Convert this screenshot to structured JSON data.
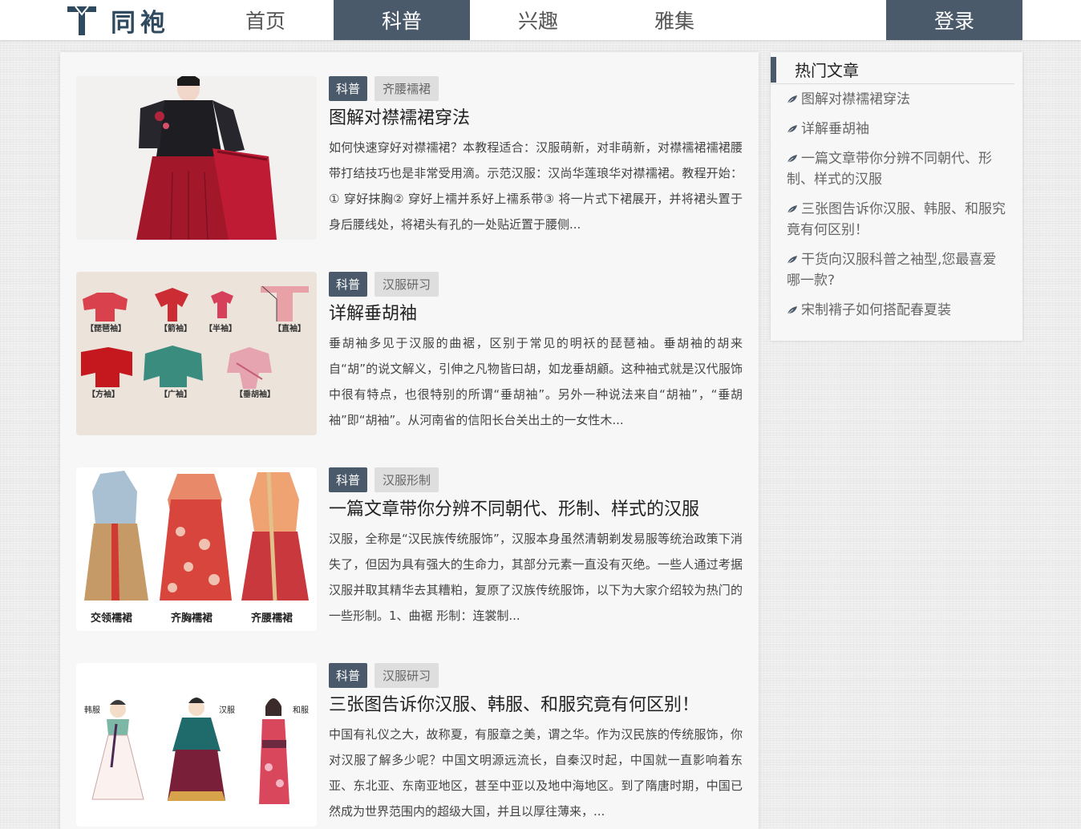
{
  "header": {
    "logo_text": "同袍",
    "nav": [
      {
        "label": "首页"
      },
      {
        "label": "科普"
      },
      {
        "label": "兴趣"
      },
      {
        "label": "雅集"
      }
    ],
    "login_label": "登录"
  },
  "articles": [
    {
      "category": "科普",
      "tag": "齐腰襦裙",
      "title": "图解对襟襦裙穿法",
      "excerpt": "如何快速穿好对襟襦裙？本教程适合：汉服萌新，对非萌新，对襟襦裙襦裙腰带打结技巧也是非常受用滴。示范汉服：汉尚华莲琅华对襟襦裙。教程开始：① 穿好抹胸② 穿好上襦并系好上襦系带③ 将一片式下裙展开，并将裙头置于身后腰线处，将裙头有孔的一处贴近置于腰侧..."
    },
    {
      "category": "科普",
      "tag": "汉服研习",
      "title": "详解垂胡袖",
      "excerpt": "垂胡袖多见于汉服的曲裾，区别于常见的明袄的琵琶袖。垂胡袖的胡来自“胡”的说文解义，引伸之凡物皆曰胡，如龙垂胡顧。这种袖式就是汉代服饰中很有特点，也很特别的所谓“垂胡袖”。另外一种说法来自“胡袖”，“垂胡袖”即“胡袖”。从河南省的信阳长台关出土的一女性木...",
      "image_labels": [
        "【琵琶袖】",
        "【箭袖】",
        "【半袖】",
        "【直袖】",
        "【方袖】",
        "【广袖】",
        "【垂胡袖】"
      ]
    },
    {
      "category": "科普",
      "tag": "汉服形制",
      "title": "一篇文章带你分辨不同朝代、形制、样式的汉服",
      "excerpt": "汉服，全称是“汉民族传统服饰”，汉服本身虽然清朝剃发易服等统治政策下消失了，但因为具有强大的生命力，其部分元素一直没有灭绝。一些人通过考据汉服并取其精华去其糟粕，复原了汉族传统服饰，以下为大家介绍较为热门的一些形制。1、曲裾 形制：连裳制...",
      "image_labels": [
        "交领襦裙",
        "齐胸襦裙",
        "齐腰襦裙"
      ]
    },
    {
      "category": "科普",
      "tag": "汉服研习",
      "title": "三张图告诉你汉服、韩服、和服究竟有何区别！",
      "excerpt": "中国有礼仪之大，故称夏，有服章之美，谓之华。作为汉民族的传统服饰，你对汉服了解多少呢？中国文明源远流长，自秦汉时起，中国就一直影响着东亚、东北亚、东南亚地区，甚至中亚以及地中海地区。到了隋唐时期，中国已然成为世界范围内的超级大国，并且以厚往薄来，...",
      "image_labels": [
        "韩服",
        "汉服",
        "和服"
      ]
    }
  ],
  "sidebar": {
    "title": "热门文章",
    "items": [
      "图解对襟襦裙穿法",
      "详解垂胡袖",
      "一篇文章带你分辨不同朝代、形制、样式的汉服",
      "三张图告诉你汉服、韩服、和服究竟有何区别！",
      "干货向汉服科普之袖型,您最喜爱哪一款?",
      "宋制褙子如何搭配春夏装"
    ]
  },
  "colors": {
    "accent": "#4b5a6a",
    "logo": "#2f4a5e",
    "tag_bg": "#dedede",
    "panel": "#f7f7f7"
  },
  "icons": {
    "logo": "hanfu-logo-icon",
    "list_bullet": "leaf-icon"
  }
}
